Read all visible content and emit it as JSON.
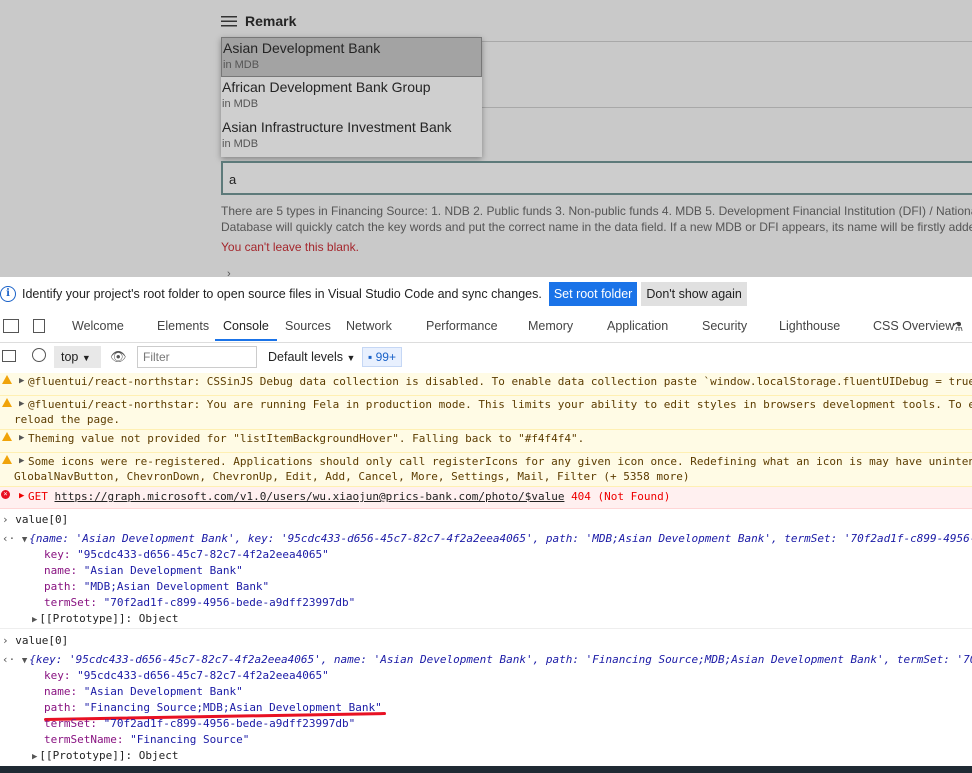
{
  "form": {
    "remark_label": "Remark",
    "dropdown": [
      {
        "name": "Asian Development Bank",
        "sub": "in MDB"
      },
      {
        "name": "African Development Bank Group",
        "sub": "in MDB"
      },
      {
        "name": "Asian Infrastructure Investment Bank",
        "sub": "in MDB"
      }
    ],
    "input_value": "a",
    "help_line1": "There are 5 types in Financing Source: 1. NDB 2. Public funds 3. Non-public funds 4. MDB 5. Development Financial Institution (DFI) / National",
    "help_line2": "Database will quickly catch the key words and put the correct name in the data field. If a new MDB or DFI appears, its name will be firstly added",
    "error": "You can't leave this blank."
  },
  "infobar": {
    "text": "Identify your project's root folder to open source files in Visual Studio Code and sync changes.",
    "primary": "Set root folder",
    "secondary": "Don't show again"
  },
  "tabs": [
    "Welcome",
    "Elements",
    "Console",
    "Sources",
    "Network",
    "Performance",
    "Memory",
    "Application",
    "Security",
    "Lighthouse",
    "CSS Overview"
  ],
  "toolbar": {
    "context": "top",
    "filter_placeholder": "Filter",
    "levels": "Default levels",
    "badge": "99+"
  },
  "console": {
    "w1": "@fluentui/react-northstar: CSSinJS Debug data collection is disabled. To enable data collection paste `window.localStorage.fluentUIDebug = true",
    "w2a": "@fluentui/react-northstar: You are running Fela in production mode. This limits your ability to edit styles in browsers development tools. To e",
    "w2b": "reload the page.",
    "w3": "Theming value not provided for \"listItemBackgroundHover\". Falling back to \"#f4f4f4\".",
    "w4a": "Some icons were re-registered. Applications should only call registerIcons for any given icon once. Redefining what an icon is may have uninten",
    "w4b": "GlobalNavButton, ChevronDown, ChevronUp, Edit, Add, Cancel, More, Settings, Mail, Filter (+ 5358 more)",
    "err_method": "GET",
    "err_url": "https://graph.microsoft.com/v1.0/users/wu.xiaojun@prics-bank.com/photo/$value",
    "err_status": "404 (Not Found)",
    "cmd1": "value[0]",
    "obj1": "{name: 'Asian Development Bank', key: '95cdc433-d656-45c7-82c7-4f2a2eea4065', path: 'MDB;Asian Development Bank', termSet: '70f2ad1f-c899-4956-",
    "o1_key": "\"95cdc433-d656-45c7-82c7-4f2a2eea4065\"",
    "o1_name": "\"Asian Development Bank\"",
    "o1_path": "\"MDB;Asian Development Bank\"",
    "o1_termset": "\"70f2ad1f-c899-4956-bede-a9dff23997db\"",
    "proto": "[[Prototype]]: Object",
    "cmd2": "value[0]",
    "obj2": "{key: '95cdc433-d656-45c7-82c7-4f2a2eea4065', name: 'Asian Development Bank', path: 'Financing Source;MDB;Asian Development Bank', termSet: '70",
    "o2_key": "\"95cdc433-d656-45c7-82c7-4f2a2eea4065\"",
    "o2_name": "\"Asian Development Bank\"",
    "o2_path": "\"Financing Source;MDB;Asian Development Bank\"",
    "o2_termset": "\"70f2ad1f-c899-4956-bede-a9dff23997db\"",
    "o2_termsetname": "\"Financing Source\""
  }
}
